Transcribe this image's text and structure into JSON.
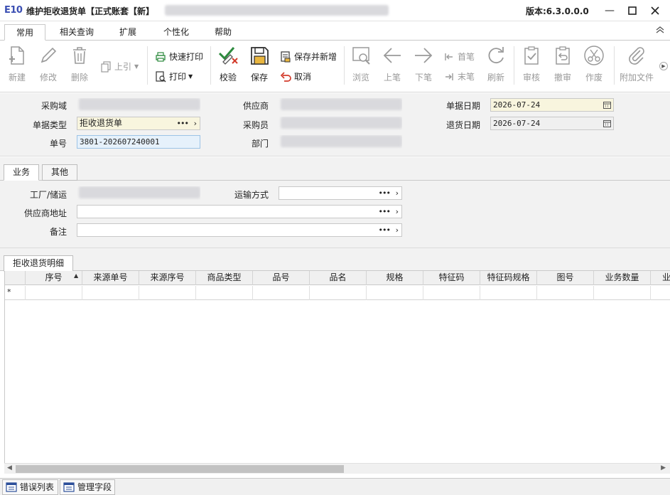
{
  "window": {
    "logo": "E10",
    "title": "维护拒收退货单【正式账套【新】",
    "version": "版本:6.3.0.0.0",
    "min_icon": "minimize-icon",
    "max_icon": "maximize-icon",
    "close_icon": "close-icon"
  },
  "ribbon_tabs": [
    {
      "label": "常用",
      "active": true
    },
    {
      "label": "相关查询",
      "active": false
    },
    {
      "label": "扩展",
      "active": false
    },
    {
      "label": "个性化",
      "active": false
    },
    {
      "label": "帮助",
      "active": false
    }
  ],
  "toolbar": {
    "new": "新建",
    "modify": "修改",
    "delete": "删除",
    "upper_ref": "上引",
    "quick_print": "快速打印",
    "print": "打印",
    "verify": "校验",
    "save": "保存",
    "save_new": "保存并新增",
    "cancel": "取消",
    "browse": "浏览",
    "prev": "上笔",
    "next": "下笔",
    "first": "首笔",
    "last": "末笔",
    "refresh": "刷新",
    "approve": "审核",
    "unapprove": "撤审",
    "void": "作废",
    "attach": "附加文件"
  },
  "header": {
    "purchase_domain_label": "采购域",
    "doc_type_label": "单据类型",
    "doc_type_value": "拒收退货单",
    "doc_no_label": "单号",
    "doc_no_value": "3801-202607240001",
    "supplier_label": "供应商",
    "buyer_label": "采购员",
    "dept_label": "部门",
    "doc_date_label": "单据日期",
    "doc_date_value": "2026-07-24",
    "return_date_label": "退货日期",
    "return_date_value": "2026-07-24"
  },
  "sub_tabs": [
    {
      "label": "业务",
      "active": true
    },
    {
      "label": "其他",
      "active": false
    }
  ],
  "detail": {
    "plant_label": "工厂/储运",
    "transport_label": "运输方式",
    "supplier_addr_label": "供应商地址",
    "remark_label": "备注"
  },
  "grid": {
    "tab_label": "拒收退货明细",
    "new_row_marker": "*",
    "columns": [
      "序号",
      "来源单号",
      "来源序号",
      "商品类型",
      "品号",
      "品名",
      "规格",
      "特征码",
      "特征码规格",
      "图号",
      "业务数量",
      "业"
    ]
  },
  "bottom_tabs": [
    "错误列表",
    "管理字段"
  ]
}
